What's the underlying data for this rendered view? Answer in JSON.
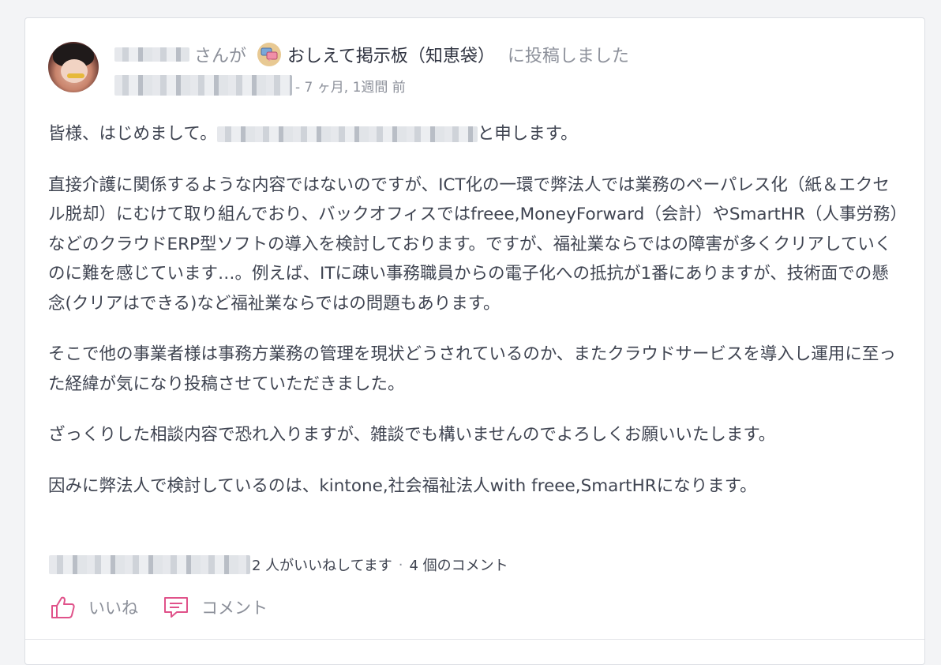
{
  "post": {
    "author_suffix": "さんが",
    "group_name": "おしえて掲示板（知恵袋）",
    "action_text": "に投稿しました",
    "time_ago": "- 7 ヶ月, 1週間 前",
    "paragraph1_start": "皆様、はじめまして。",
    "paragraph1_end": "と申します。",
    "paragraph2": "直接介護に関係するような内容ではないのですが、ICT化の一環で弊法人では業務のペーパレス化（紙＆エクセル脱却）にむけて取り組んでおり、バックオフィスではfreee,MoneyForward（会計）やSmartHR（人事労務）などのクラウドERP型ソフトの導入を検討しております。ですが、福祉業ならではの障害が多くクリアしていくのに難を感じています…。例えば、ITに疎い事務職員からの電子化への抵抗が1番にありますが、技術面での懸念(クリアはできる)など福祉業ならではの問題もあります。",
    "paragraph3": "そこで他の事業者様は事務方業務の管理を現状どうされているのか、またクラウドサービスを導入し運用に至った経緯が気になり投稿させていただきました。",
    "paragraph4": "ざっくりした相談内容で恐れ入りますが、雑談でも構いませんのでよろしくお願いいたします。",
    "paragraph5": "因みに弊法人で検討しているのは、kintone,社会福祉法人with freee,SmartHRになります。"
  },
  "stats": {
    "likes_text": "2 人がいいねしてます",
    "separator": "·",
    "comments_text": "4 個のコメント"
  },
  "actions": {
    "like_label": "いいね",
    "comment_label": "コメント"
  },
  "colors": {
    "text": "#3f4451",
    "muted": "#8c909a",
    "action_icon": "#e0528a"
  },
  "icons": {
    "group": "chat-bubbles-icon",
    "like": "thumbs-up-icon",
    "comment": "comment-icon"
  }
}
